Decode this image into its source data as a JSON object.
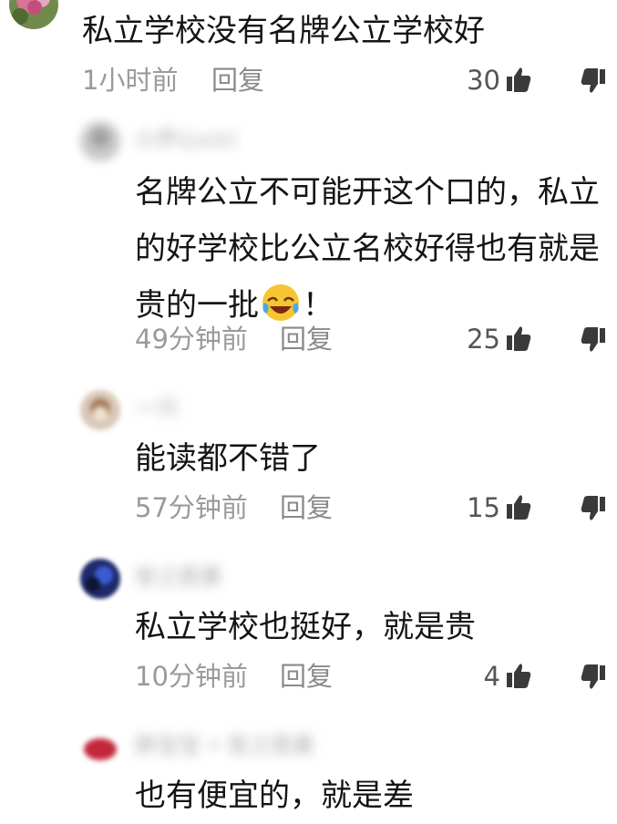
{
  "comments": [
    {
      "text_lines": [
        "私立学校没有名牌公立学校好"
      ],
      "time": "1小时前",
      "reply": "回复",
      "likes": "30"
    },
    {
      "username": "小乔心cici",
      "text_lines": [
        "名牌公立不可能开这个口的，私立",
        "的好学校比公立名校好得也有就是",
        "贵的一批",
        "！"
      ],
      "emoji": "laughing-crying-emoji",
      "time": "49分钟前",
      "reply": "回复",
      "likes": "25"
    },
    {
      "username": "一只",
      "text_lines": [
        "能读都不错了"
      ],
      "time": "57分钟前",
      "reply": "回复",
      "likes": "15"
    },
    {
      "username": "安之若素",
      "text_lines": [
        "私立学校也挺好，就是贵"
      ],
      "time": "10分钟前",
      "reply": "回复",
      "likes": "4"
    },
    {
      "username": "胖宝宝 • 安之若素",
      "text_lines": [
        "也有便宜的，就是差"
      ]
    }
  ],
  "colors": {
    "text": "#141414",
    "meta": "#9a9a9a",
    "icon": "#3a3a3a"
  }
}
